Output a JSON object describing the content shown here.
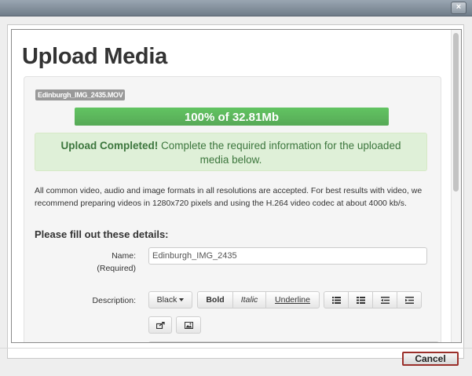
{
  "window": {
    "close_symbol": "×"
  },
  "page": {
    "title": "Upload Media"
  },
  "upload": {
    "filename": "Edinburgh_IMG_2435.MOV",
    "progress_text": "100% of 32.81Mb",
    "progress_fraction": 1.0,
    "alert_strong": "Upload Completed!",
    "alert_text": " Complete the required information for the uploaded media below."
  },
  "info_text": "All common video, audio and image formats in all resolutions are accepted.  For best results with video, we recommend preparing videos in 1280x720 pixels and using the H.264 video codec at about 4000 kb/s.",
  "form": {
    "heading": "Please fill out these details:",
    "name_label": "Name:",
    "name_required": "(Required)",
    "name_value": "Edinburgh_IMG_2435",
    "description_label": "Description:"
  },
  "toolbar": {
    "color_label": "Black",
    "bold_label": "Bold",
    "italic_label": "Italic",
    "underline_label": "Underline",
    "icons": [
      "unordered-list-icon",
      "ordered-list-icon",
      "outdent-icon",
      "indent-icon",
      "link-icon",
      "image-icon"
    ]
  },
  "footer": {
    "cancel_label": "Cancel"
  },
  "colors": {
    "success": "#5cb85c",
    "alert_bg": "#dff0d8",
    "cancel_border": "#9b2f2a"
  }
}
